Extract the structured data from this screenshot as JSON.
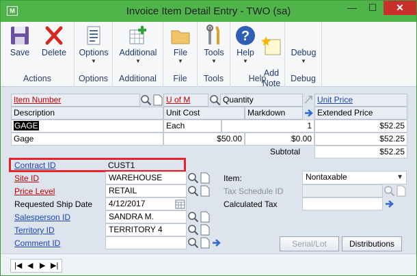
{
  "window": {
    "title": "Invoice Item Detail Entry  -  TWO (sa)",
    "app_glyph": "M​"
  },
  "ribbon": {
    "groups": [
      {
        "label": "Actions",
        "buttons": [
          {
            "label": "Save",
            "icon": "floppy-icon"
          },
          {
            "label": "Delete",
            "icon": "red-x-icon"
          }
        ]
      },
      {
        "label": "Options",
        "buttons": [
          {
            "label": "Options",
            "icon": "list-icon"
          }
        ]
      },
      {
        "label": "Additional",
        "buttons": [
          {
            "label": "Additional",
            "icon": "grid-add-icon"
          }
        ]
      },
      {
        "label": "File",
        "buttons": [
          {
            "label": "File",
            "icon": "folder-icon"
          }
        ]
      },
      {
        "label": "Tools",
        "buttons": [
          {
            "label": "Tools",
            "icon": "tools-icon"
          }
        ]
      },
      {
        "label": "Help",
        "buttons": [
          {
            "label": "Help",
            "icon": "help-icon"
          },
          {
            "label": "Add\nNote",
            "icon": "note-icon"
          }
        ]
      },
      {
        "label": "Debug",
        "buttons": [
          {
            "label": "Debug",
            "icon": "debug-icon"
          }
        ]
      }
    ]
  },
  "grid": {
    "h_item_number": "Item Number",
    "h_uofm": "U of M",
    "h_quantity": "Quantity",
    "h_unit_price": "Unit Price",
    "h_description": "Description",
    "h_unit_cost": "Unit Cost",
    "h_markdown": "Markdown",
    "h_extended_price": "Extended Price",
    "item_number": "GAGE",
    "uofm": "Each",
    "quantity": "1",
    "unit_price": "$52.25",
    "description": "Gage",
    "unit_cost": "$50.00",
    "markdown": "$0.00",
    "extended_price": "$52.25",
    "subtotal_label": "Subtotal",
    "subtotal": "$52.25"
  },
  "fields": {
    "contract_id_label": "Contract ID",
    "contract_id": "CUST1",
    "site_id_label": "Site ID",
    "site_id": "WAREHOUSE",
    "price_level_label": "Price Level",
    "price_level": "RETAIL",
    "ship_date_label": "Requested Ship Date",
    "ship_date": "4/12/2017",
    "salesperson_label": "Salesperson ID",
    "salesperson": "SANDRA M.",
    "territory_label": "Territory ID",
    "territory": "TERRITORY 4",
    "comment_label": "Comment ID",
    "comment": "",
    "item_label": "Item:",
    "item": "Nontaxable",
    "tax_schedule_label": "Tax Schedule ID",
    "tax_schedule": "",
    "calc_tax_label": "Calculated Tax",
    "calc_tax": ""
  },
  "buttons": {
    "serial_lot": "Serial/Lot",
    "distributions": "Distributions"
  },
  "colors": {
    "title_bar": "#4fb54a",
    "highlight_box": "#e8202a",
    "required_label": "#c00000",
    "link_label": "#1a44b5"
  }
}
